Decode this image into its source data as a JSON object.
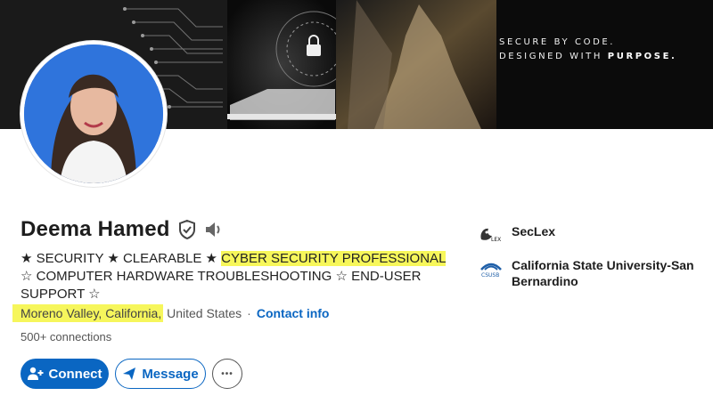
{
  "banner": {
    "tagline_line1": "SECURE BY CODE.",
    "tagline_line2_prefix": "DESIGNED WITH ",
    "tagline_line2_bold": "PURPOSE."
  },
  "profile": {
    "name": "Deema Hamed",
    "headline_part1": "★ SECURITY ★ CLEARABLE ★ ",
    "headline_highlight": "CYBER SECURITY PROFESSIONAL",
    "headline_part2": "  ☆ COMPUTER HARDWARE TROUBLESHOOTING ☆ END-USER SUPPORT ☆",
    "location_highlight": "Moreno Valley, California,",
    "location_rest": " United States",
    "location_separator": "·",
    "contact_info": "Contact info",
    "connections": "500+ connections"
  },
  "actions": {
    "connect": "Connect",
    "message": "Message",
    "more": "•••"
  },
  "experience": [
    {
      "name": "SecLex",
      "logo_text": "LEX"
    },
    {
      "name": "California State University-San Bernardino",
      "logo_text": "CSUSB"
    }
  ],
  "colors": {
    "accent": "#0a66c2",
    "highlight": "#f7f75a"
  }
}
